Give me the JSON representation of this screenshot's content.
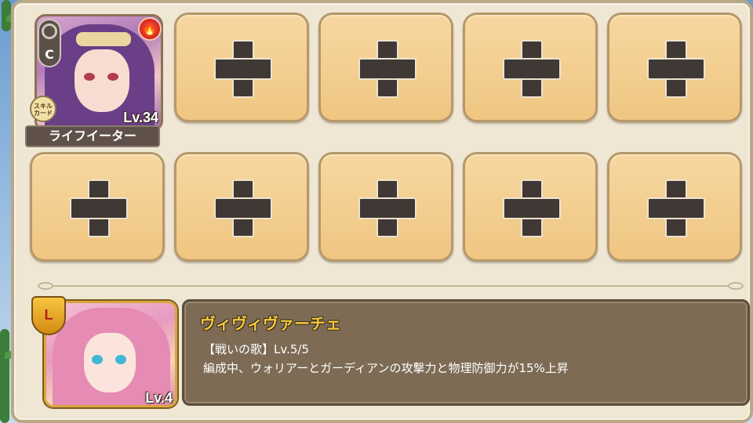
{
  "party": {
    "member1": {
      "name": "ライフイーター",
      "level": "Lv.34",
      "rarity": "C",
      "element_icon": "fire-icon",
      "skill_card_label": "スキルカード"
    },
    "empty_slot_icon": "plus-icon",
    "empty_slot_count": 9
  },
  "leader": {
    "badge": "L",
    "level": "Lv.4",
    "skill_name": "ヴィヴィヴァーチェ",
    "skill_title_line": "【戦いの歌】Lv.5/5",
    "skill_description": "編成中、ウォリアーとガーディアンの攻撃力と物理防御力が15%上昇"
  },
  "colors": {
    "slot_fill": "#efc681",
    "skill_box": "#7d6b55",
    "skill_name": "#f6c93a"
  }
}
